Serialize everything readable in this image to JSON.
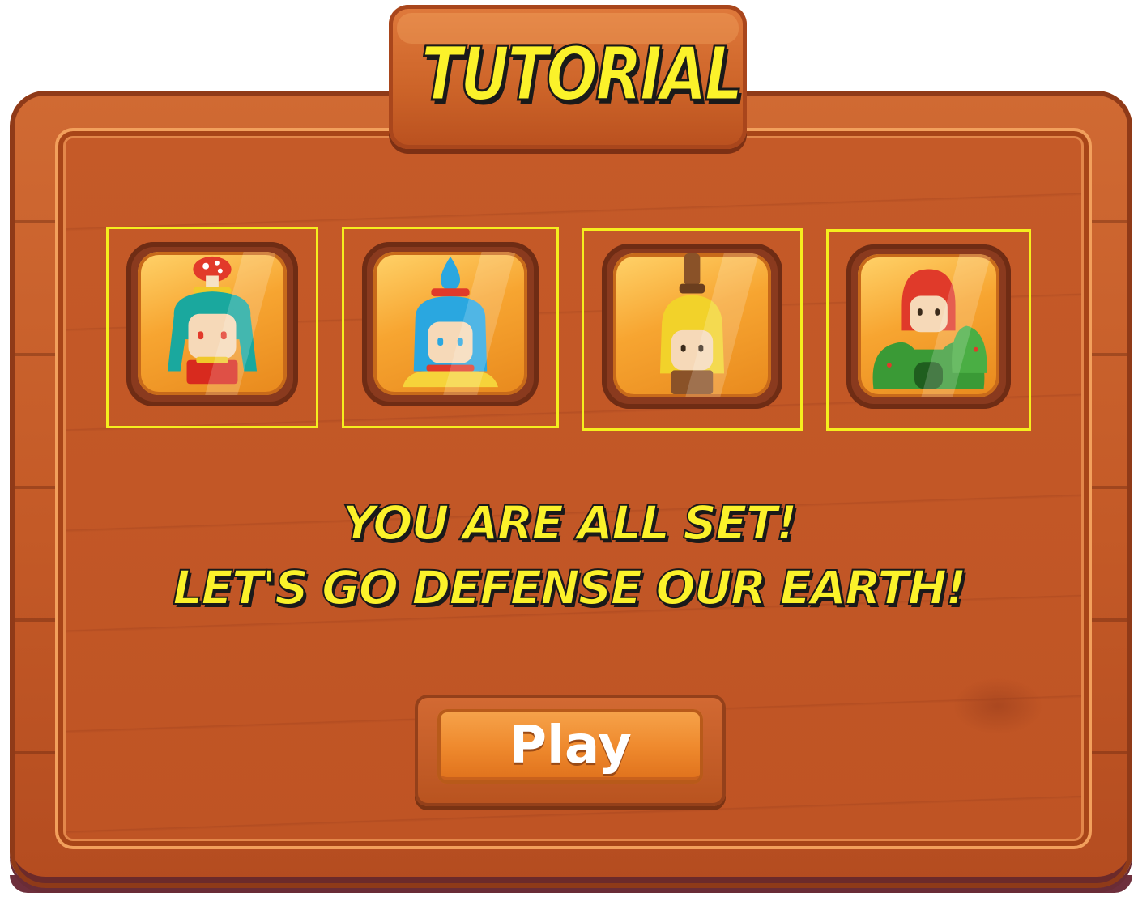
{
  "title": "TUTORIAL",
  "characters": [
    {
      "name": "mushroom-character-icon",
      "hair": "#1aa89e",
      "accent": "#e23a2a"
    },
    {
      "name": "water-drop-character-icon",
      "hair": "#2aa7e0",
      "accent": "#e03a2a"
    },
    {
      "name": "banana-character-icon",
      "hair": "#f2d22a",
      "accent": "#7a4a24"
    },
    {
      "name": "cactus-character-icon",
      "hair": "#e03a2a",
      "accent": "#3a9a36"
    }
  ],
  "message": {
    "line1": "YOU ARE ALL SET!",
    "line2": "LET'S GO DEFENSE OUR EARTH!"
  },
  "play_button": {
    "label": "Play"
  },
  "colors": {
    "title_text": "#fbf22a",
    "slot_outline": "#f5ee1e",
    "wood": "#c55a28",
    "button": "#ef8a2e"
  }
}
